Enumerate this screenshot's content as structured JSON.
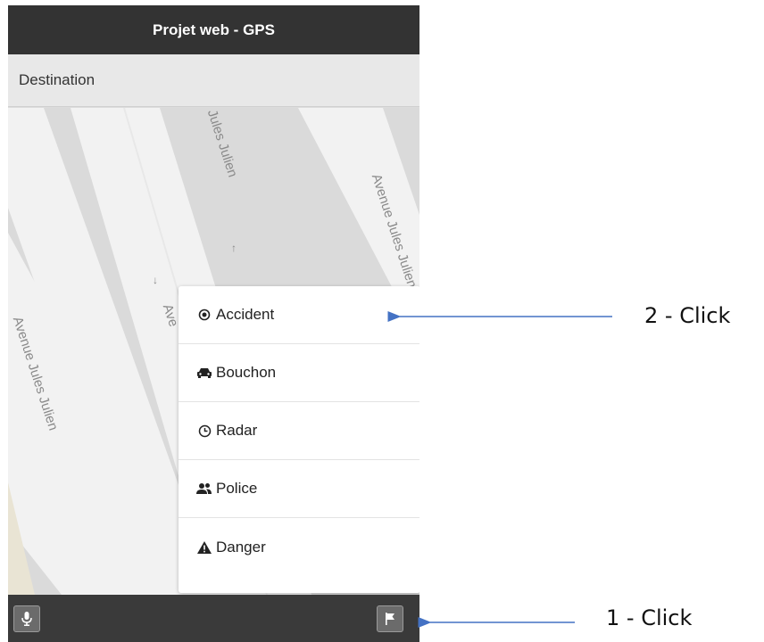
{
  "app": {
    "title": "Projet web - GPS"
  },
  "search": {
    "placeholder": "Destination"
  },
  "map": {
    "labels": [
      "Jules Julien",
      "Avenue Jules Julien",
      "Avenue Jules Julien",
      "Ave"
    ],
    "arrows": [
      "↑",
      "↓"
    ]
  },
  "menu": {
    "items": [
      {
        "label": "Accident",
        "icon": "target-icon"
      },
      {
        "label": "Bouchon",
        "icon": "car-icon"
      },
      {
        "label": "Radar",
        "icon": "clock-icon"
      },
      {
        "label": "Police",
        "icon": "users-icon"
      },
      {
        "label": "Danger",
        "icon": "warning-icon"
      }
    ]
  },
  "toolbar": {
    "mic_icon": "microphone-icon",
    "flag_icon": "flag-icon"
  },
  "annotations": {
    "step1": "1 - Click",
    "step2": "2 - Click",
    "arrow_color": "#4472c4"
  }
}
